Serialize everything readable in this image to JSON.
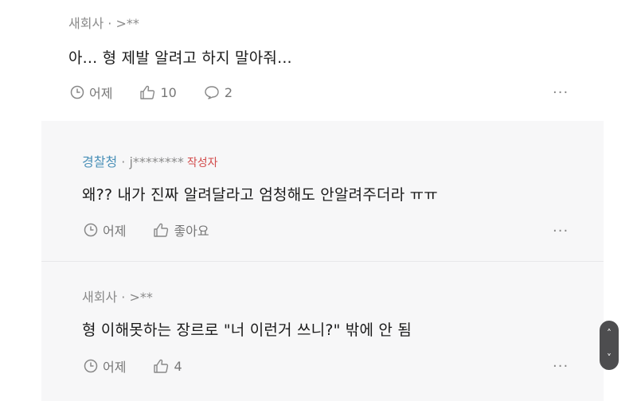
{
  "comments": [
    {
      "author": "새회사",
      "separator": " · ",
      "handle": ">**",
      "text": "아... 형 제발 알려고 하지 말아줘...",
      "time": "어제",
      "likes": "10",
      "replies": "2",
      "more": "···"
    },
    {
      "author": "경찰청",
      "separator": " · ",
      "handle": "j********",
      "badge": "작성자",
      "text": "왜?? 내가 진짜 알려달라고 엄청해도 안알려주더라 ㅠㅠ",
      "time": "어제",
      "likes": "좋아요",
      "more": "···"
    },
    {
      "author": "새회사",
      "separator": " · ",
      "handle": ">**",
      "text": "형 이해못하는 장르로 \"너 이런거 쓰니?\" 밖에 안 됨",
      "time": "어제",
      "likes": "4",
      "more": "···"
    }
  ],
  "scroll_control": {
    "up": "˄",
    "down": "˅"
  },
  "colors": {
    "author_highlight": "#4a90b8",
    "badge": "#d24b4b",
    "reply_bg": "#f7f7f8"
  }
}
